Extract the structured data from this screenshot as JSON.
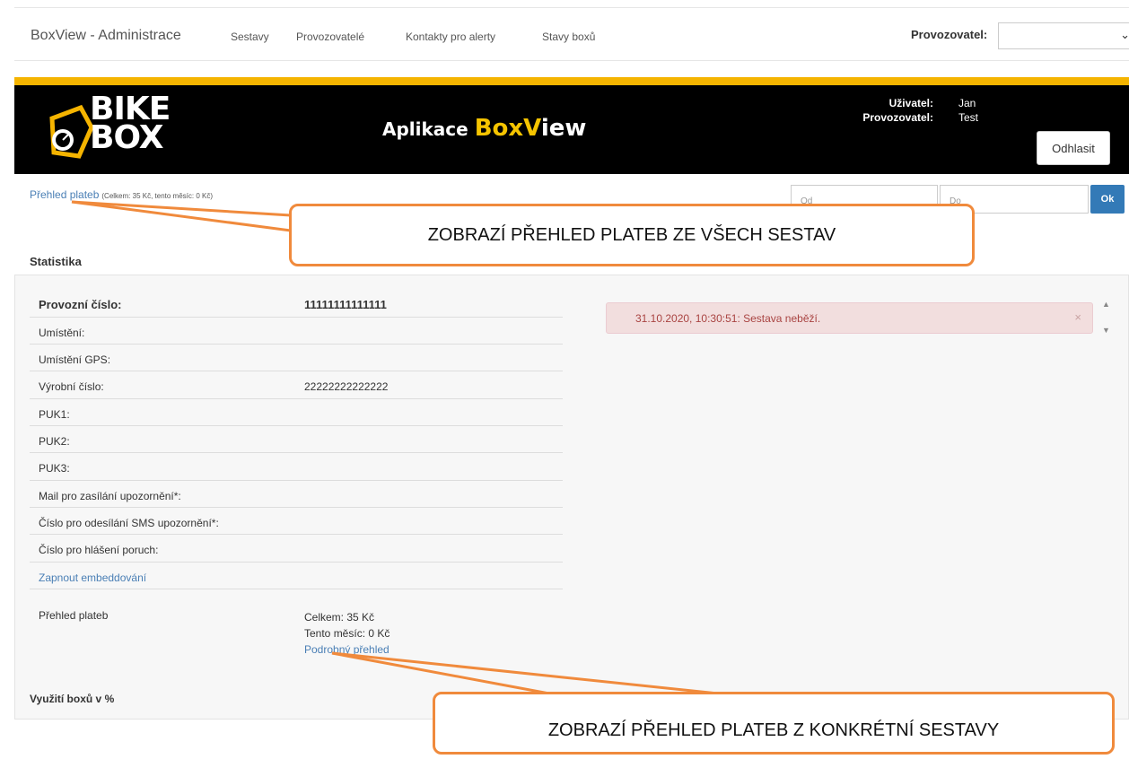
{
  "nav": {
    "brand": "BoxView - Administrace",
    "links": [
      "Sestavy",
      "Provozovatelé",
      "Kontakty pro alerty",
      "Stavy boxů"
    ],
    "provider_label": "Provozovatel:",
    "provider_value": ""
  },
  "banner": {
    "logo_line1": "BIKE",
    "logo_line2": "BOX",
    "app_prefix": "Aplikace ",
    "app_box": "Box",
    "app_v": "V",
    "app_iew": "iew",
    "user_label": "Uživatel:",
    "user_value": "Jan",
    "provider_label": "Provozovatel:",
    "provider_value": "Test",
    "logout": "Odhlasit"
  },
  "filter": {
    "payments_link": "Přehled plateb",
    "payments_note": "(Celkem: 35 Kč, tento měsíc: 0 Kč)",
    "from_placeholder": "Od",
    "to_placeholder": "Do",
    "ok": "Ok"
  },
  "stats": {
    "heading": "Statistika",
    "rows": [
      {
        "label": "Provozní číslo:",
        "value": "11111111111111"
      },
      {
        "label": "Umístění:",
        "value": ""
      },
      {
        "label": "Umístění GPS:",
        "value": ""
      },
      {
        "label": "Výrobní číslo:",
        "value": "22222222222222"
      },
      {
        "label": "PUK1:",
        "value": ""
      },
      {
        "label": "PUK2:",
        "value": ""
      },
      {
        "label": "PUK3:",
        "value": ""
      },
      {
        "label": "Mail pro zasílání upozornění*:",
        "value": ""
      },
      {
        "label": "Číslo pro odesílání SMS upozornění*:",
        "value": ""
      },
      {
        "label": "Číslo pro hlášení poruch:",
        "value": ""
      },
      {
        "label": "Zapnout embeddování",
        "value": ""
      }
    ],
    "payments_label": "Přehled plateb",
    "payments_total": "Celkem: 35 Kč",
    "payments_month": "Tento měsíc: 0 Kč",
    "payments_detail": "Podrobný přehled",
    "usage_heading": "Využití boxů v %"
  },
  "alert": {
    "text": "31.10.2020, 10:30:51: Sestava neběží.",
    "close": "×"
  },
  "annotations": {
    "top": "ZOBRAZÍ PŘEHLED PLATEB ZE VŠECH SESTAV",
    "bottom": "ZOBRAZÍ PŘEHLED PLATEB Z KONKRÉTNÍ SESTAVY"
  },
  "colors": {
    "accent": "#f5b400",
    "link": "#4a7fb5",
    "callout_border": "#f08a3c",
    "alert_bg": "#f2dede",
    "ok_button": "#337ab7"
  }
}
